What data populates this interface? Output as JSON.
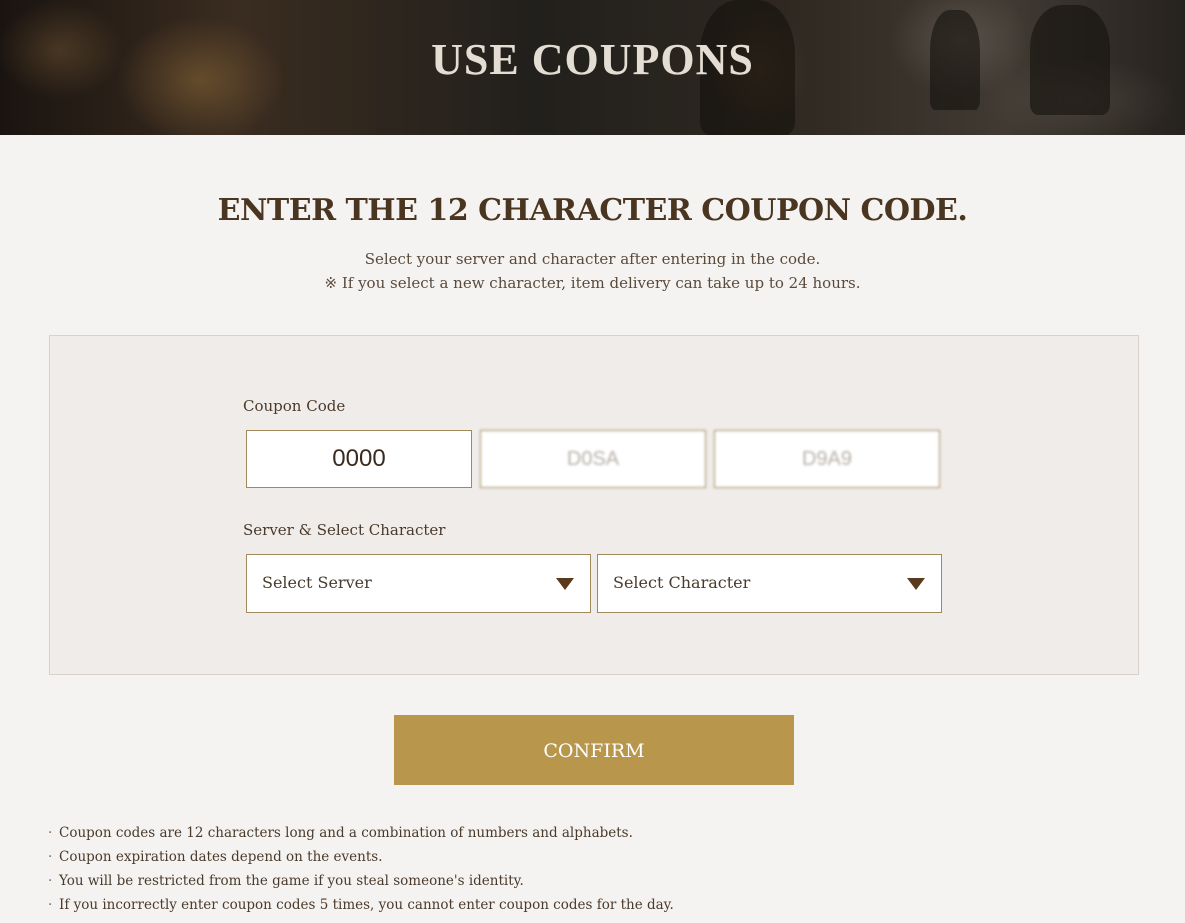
{
  "hero": {
    "title": "USE COUPONS"
  },
  "intro": {
    "heading": "ENTER THE 12 CHARACTER COUPON CODE.",
    "line1": "Select your server and character after entering in the code.",
    "line2": "※ If you select a new character, item delivery can take up to 24 hours."
  },
  "form": {
    "coupon_label": "Coupon Code",
    "code_parts": [
      "0000",
      "D0SA",
      "D9A9"
    ],
    "server_section_label": "Server & Select Character",
    "server_select": "Select Server",
    "character_select": "Select Character"
  },
  "confirm_label": "CONFIRM",
  "notes": {
    "bullet": "·",
    "items": [
      "Coupon codes are 12 characters long and a combination of numbers and alphabets.",
      "Coupon expiration dates depend on the events.",
      "You will be restricted from the game if you steal someone's identity.",
      "If you incorrectly enter coupon codes 5 times, you cannot enter coupon codes for the day."
    ]
  },
  "colors": {
    "accent": "#b8974d",
    "heading": "#4a3520",
    "border": "#a08a5c",
    "background": "#f5f3f1"
  }
}
